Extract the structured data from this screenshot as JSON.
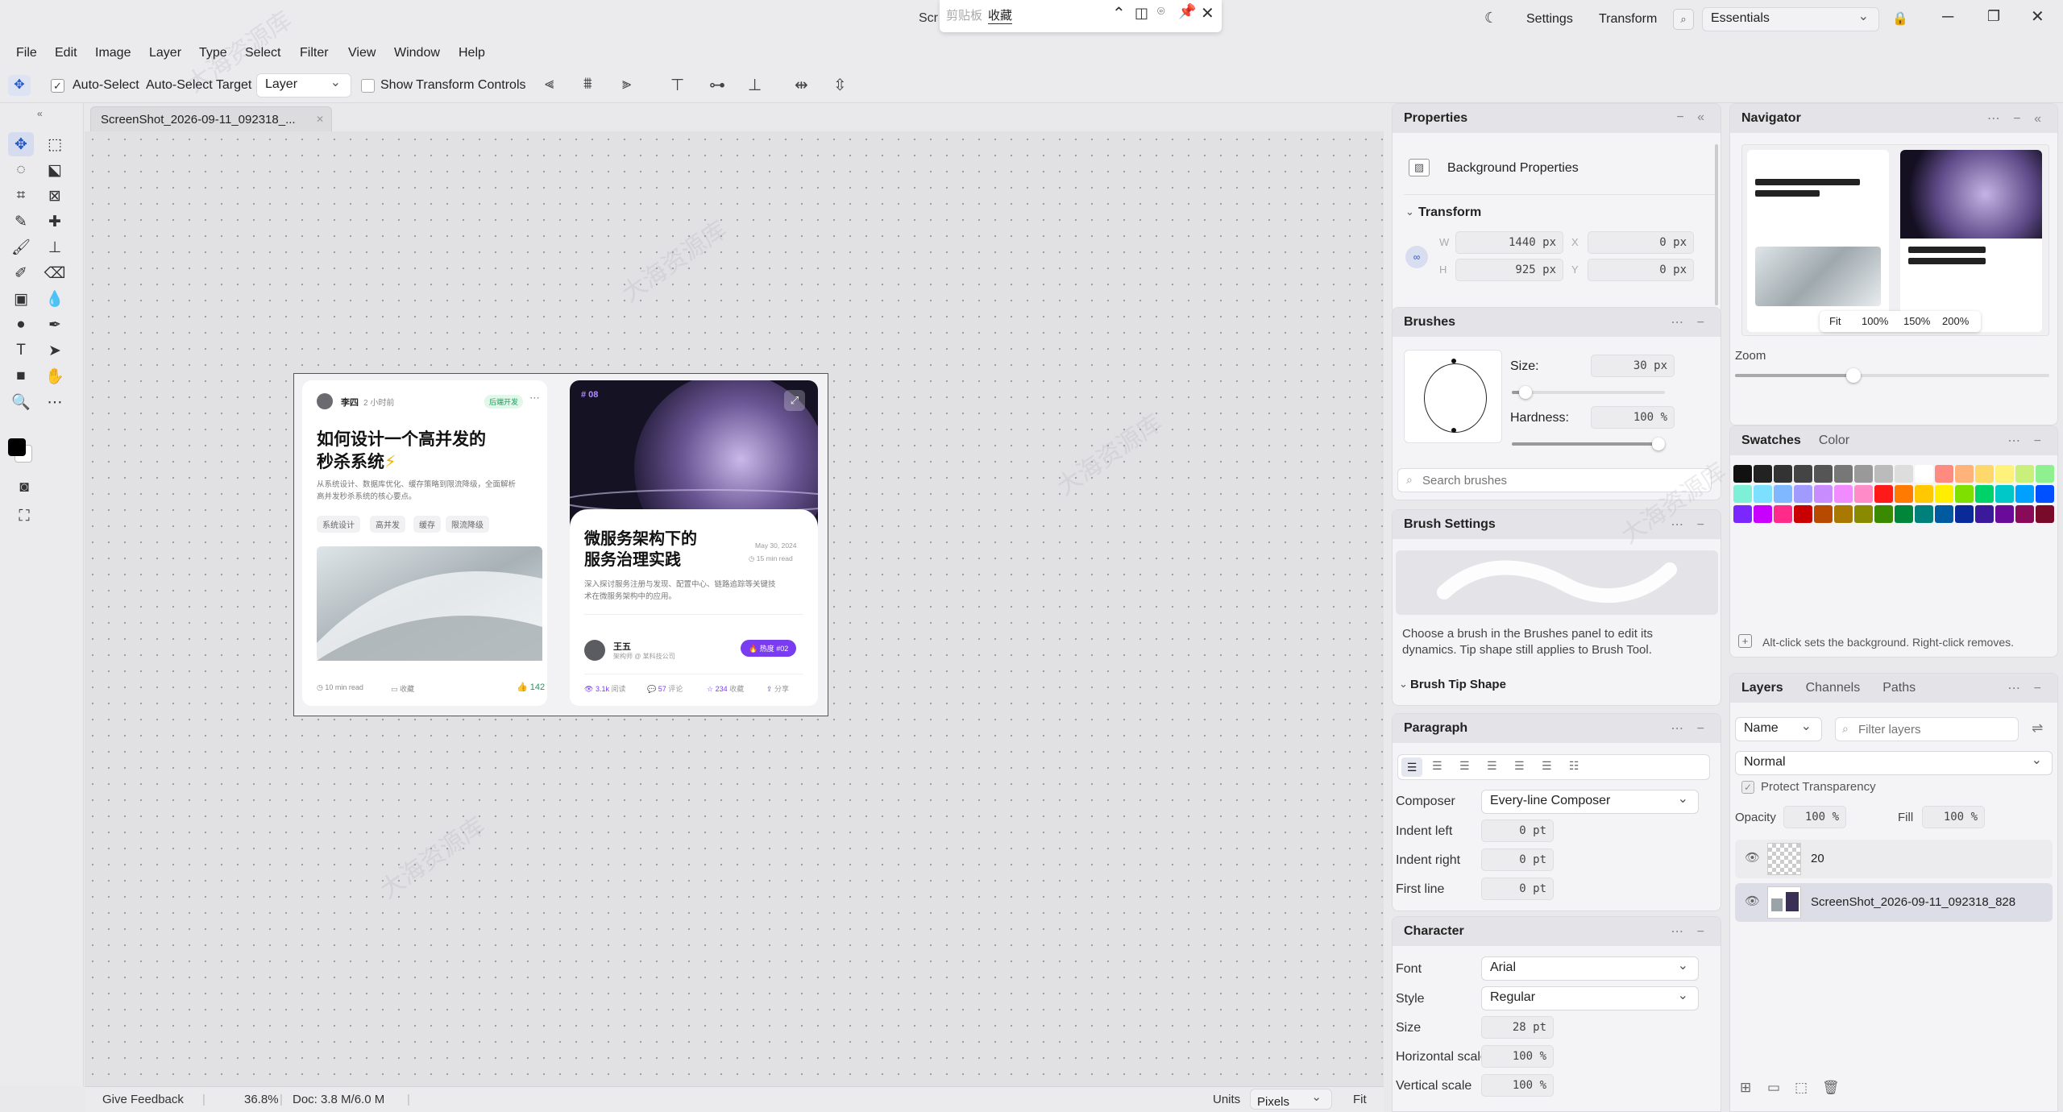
{
  "titlebar": {
    "title_fragment": "Scr",
    "clip_left": "剪贴板",
    "clip_right": "收藏",
    "settings": "Settings",
    "transform": "Transform",
    "workspace": "Essentials"
  },
  "menu": [
    "File",
    "Edit",
    "Image",
    "Layer",
    "Type",
    "Select",
    "Filter",
    "View",
    "Window",
    "Help"
  ],
  "options": {
    "auto_select": "Auto-Select",
    "auto_select_target": "Auto-Select Target",
    "target_value": "Layer",
    "show_transform": "Show Transform Controls"
  },
  "document": {
    "tab": "ScreenShot_2026-09-11_092318_...",
    "zoom": "36.8%",
    "doc_size": "Doc: 3.8 M/6.0 M",
    "feedback": "Give Feedback",
    "units_label": "Units",
    "units_value": "Pixels",
    "fit": "Fit"
  },
  "artwork": {
    "left": {
      "author": "李四",
      "time": "2 小时前",
      "badge": "后端开发",
      "title1": "如何设计一个高并发的",
      "title2": "秒杀系统",
      "desc1": "从系统设计、数据库优化、缓存策略到限流降级，全面解析",
      "desc2": "高并发秒杀系统的核心要点。",
      "tags": [
        "系统设计",
        "高并发",
        "缓存",
        "限流降级"
      ],
      "read": "10 min read",
      "save": "收藏",
      "likes": "142"
    },
    "right": {
      "number": "# 08",
      "title1": "微服务架构下的",
      "title2": "服务治理实践",
      "date": "May 30, 2024",
      "read": "15 min read",
      "desc1": "深入探讨服务注册与发现、配置中心、链路追踪等关键技",
      "desc2": "术在微服务架构中的应用。",
      "author": "王五",
      "author_role": "架构师 @ 某科技公司",
      "hot": "热度 #02",
      "stats": [
        {
          "v": "3.1k",
          "l": "阅读"
        },
        {
          "v": "57",
          "l": "评论"
        },
        {
          "v": "234",
          "l": "收藏"
        },
        {
          "v": "",
          "l": "分享"
        }
      ]
    }
  },
  "properties": {
    "title": "Properties",
    "section": "Background Properties",
    "transform": "Transform",
    "w_label": "W",
    "w": "1440",
    "h_label": "H",
    "h": "925",
    "x_label": "X",
    "x": "0",
    "y_label": "Y",
    "y": "0",
    "unit": "px"
  },
  "brushes": {
    "title": "Brushes",
    "size_label": "Size:",
    "size": "30",
    "size_unit": "px",
    "size_level": 0.05,
    "hardness_label": "Hardness:",
    "hardness": "100",
    "hardness_unit": "%",
    "hardness_level": 1.0,
    "search_placeholder": "Search brushes"
  },
  "brush_settings": {
    "title": "Brush Settings",
    "hint1": "Choose a brush in the Brushes panel to edit its",
    "hint2": "dynamics. Tip shape still applies to Brush Tool.",
    "tip_shape": "Brush Tip Shape"
  },
  "paragraph": {
    "title": "Paragraph",
    "composer_label": "Composer",
    "composer": "Every-line Composer",
    "indent_left_label": "Indent left",
    "indent_left": "0",
    "indent_right_label": "Indent right",
    "indent_right": "0",
    "first_line_label": "First line",
    "first_line": "0",
    "unit": "pt"
  },
  "character": {
    "title": "Character",
    "font_label": "Font",
    "font": "Arial",
    "style_label": "Style",
    "style": "Regular",
    "size_label": "Size",
    "size": "28",
    "size_unit": "pt",
    "hscale_label": "Horizontal scale",
    "hscale": "100",
    "vscale_label": "Vertical scale",
    "vscale": "100",
    "pct": "%"
  },
  "navigator": {
    "title": "Navigator",
    "zoom_buttons": [
      "Fit",
      "100%",
      "150%",
      "200%"
    ],
    "zoom_label": "Zoom",
    "zoom_level": 0.37
  },
  "swatches": {
    "tab_active": "Swatches",
    "tab_other": "Color",
    "hint": "Alt-click sets the background. Right-click removes.",
    "rows": [
      [
        "#111111",
        "#222222",
        "#333333",
        "#444444",
        "#555555",
        "#777777",
        "#999999",
        "#bbbbbb",
        "#dddddd",
        "#ffffff",
        "#ff8a80",
        "#ffb27a",
        "#ffd86b",
        "#fff27a",
        "#c8f07a",
        "#8ef08e"
      ],
      [
        "#7ef0d8",
        "#7ee0ff",
        "#80b8ff",
        "#a29bff",
        "#c88cff",
        "#f08cff",
        "#ff8cc8",
        "#ff1a1a",
        "#ff7a00",
        "#ffc800",
        "#ffee00",
        "#7fe000",
        "#00d26a",
        "#00c8c8",
        "#00a0ff",
        "#0050ff"
      ],
      [
        "#7a28ff",
        "#c800ff",
        "#ff2a8a",
        "#c80000",
        "#b84a00",
        "#a87800",
        "#8a8a00",
        "#3a8a00",
        "#00863a",
        "#00807a",
        "#005aa0",
        "#0a2a9a",
        "#3a1a9a",
        "#6a0a9a",
        "#8a0a5a",
        "#7a0a2a"
      ]
    ]
  },
  "layers": {
    "tabs": [
      "Layers",
      "Channels",
      "Paths"
    ],
    "filter_kind": "Name",
    "filter_placeholder": "Filter layers",
    "blend": "Normal",
    "protect": "Protect Transparency",
    "opacity_label": "Opacity",
    "opacity": "100",
    "fill_label": "Fill",
    "fill": "100",
    "pct": "%",
    "items": [
      {
        "name": "20"
      },
      {
        "name": "ScreenShot_2026-09-11_092318_828"
      }
    ]
  },
  "colors": {
    "accent": "#2557c7",
    "purple": "#7a3cf0",
    "green": "#1e9a5a"
  }
}
